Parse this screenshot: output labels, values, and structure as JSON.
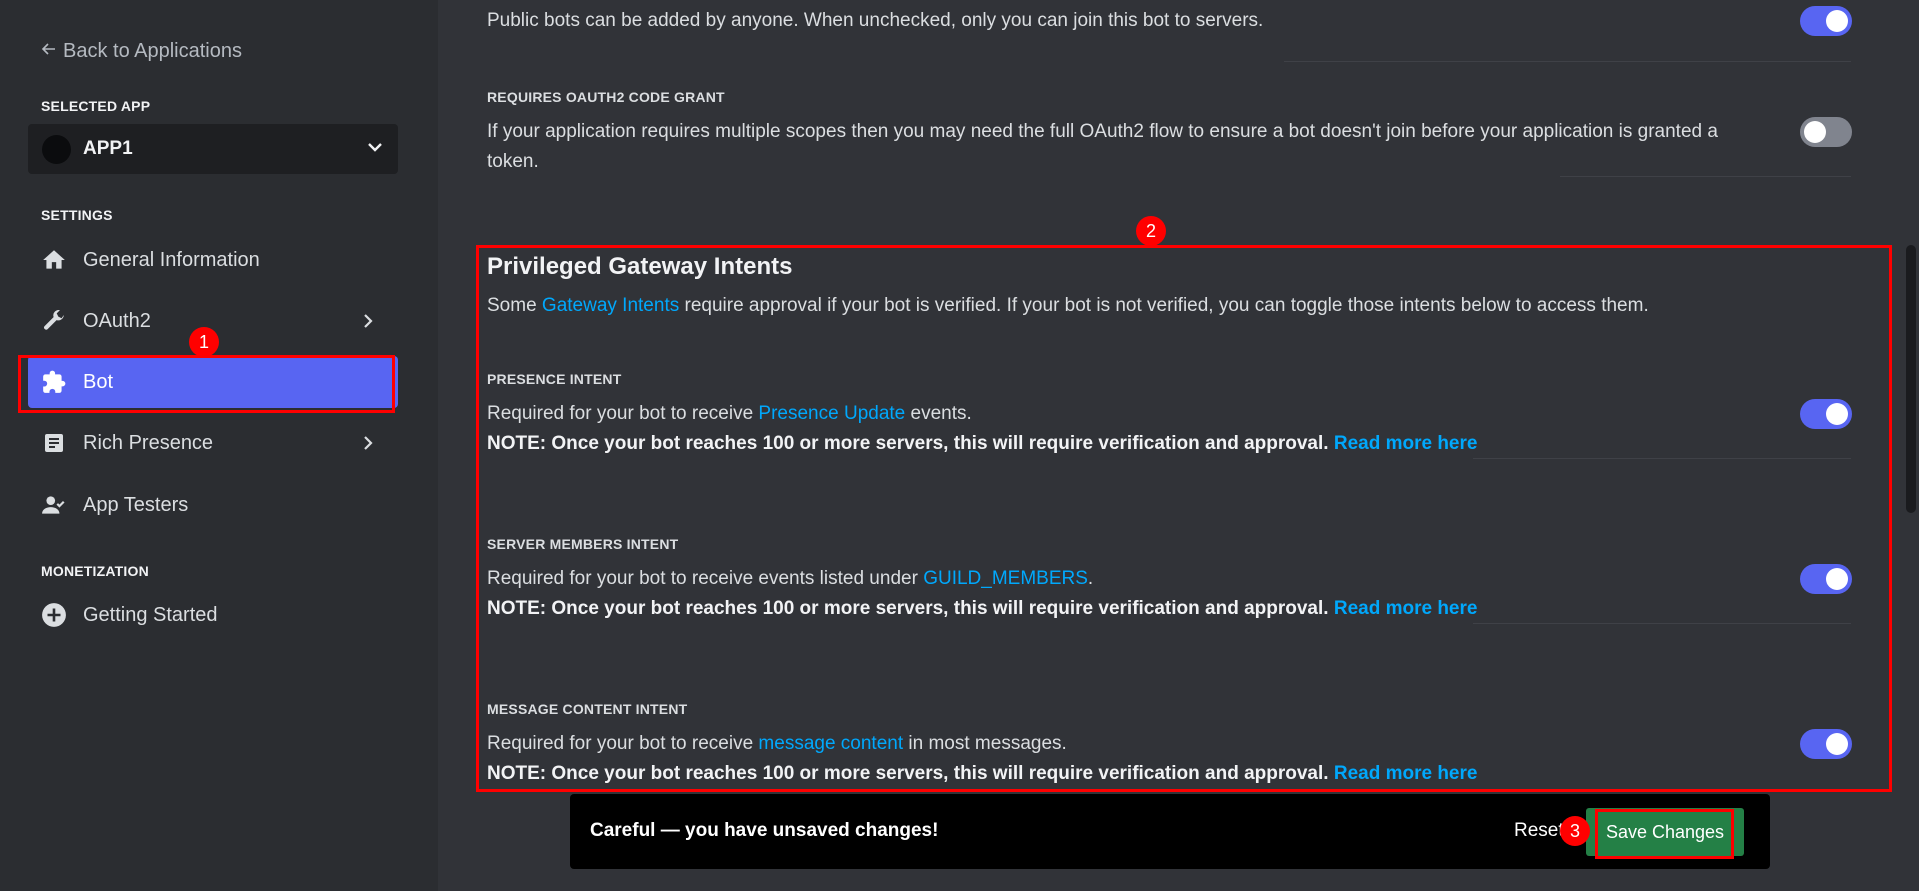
{
  "sidebar": {
    "back_label": "Back to Applications",
    "selected_app_label": "SELECTED APP",
    "app_name": "APP1",
    "settings_label": "SETTINGS",
    "items": [
      {
        "label": "General Information",
        "icon": "home-icon"
      },
      {
        "label": "OAuth2",
        "icon": "wrench-icon"
      },
      {
        "label": "Bot",
        "icon": "puzzle-icon"
      },
      {
        "label": "Rich Presence",
        "icon": "document-icon"
      },
      {
        "label": "App Testers",
        "icon": "person-icon"
      }
    ],
    "monetization_label": "MONETIZATION",
    "monetization_items": [
      {
        "label": "Getting Started",
        "icon": "plus-circle-icon"
      }
    ]
  },
  "public_bot": {
    "description": "Public bots can be added by anyone. When unchecked, only you can join this bot to servers.",
    "enabled": true
  },
  "oauth2_grant": {
    "title": "REQUIRES OAUTH2 CODE GRANT",
    "description_line1": "If your application requires multiple scopes then you may need the full OAuth2 flow to ensure a bot doesn't join before your application is granted a",
    "description_line2": "token.",
    "enabled": false
  },
  "intents": {
    "heading": "Privileged Gateway Intents",
    "intro_prefix": "Some ",
    "intro_link": "Gateway Intents",
    "intro_suffix": " require approval if your bot is verified. If your bot is not verified, you can toggle those intents below to access them.",
    "note_text": "NOTE: Once your bot reaches 100 or more servers, this will require verification and approval.",
    "read_more": "Read more here",
    "presence": {
      "title": "PRESENCE INTENT",
      "prefix": "Required for your bot to receive ",
      "link": "Presence Update",
      "suffix": " events.",
      "enabled": true
    },
    "members": {
      "title": "SERVER MEMBERS INTENT",
      "prefix": "Required for your bot to receive events listed under ",
      "link": "GUILD_MEMBERS",
      "suffix": ".",
      "enabled": true
    },
    "message_content": {
      "title": "MESSAGE CONTENT INTENT",
      "prefix": "Required for your bot to receive ",
      "link": "message content",
      "suffix": " in most messages.",
      "enabled": true
    }
  },
  "save_bar": {
    "message": "Careful — you have unsaved changes!",
    "reset_label": "Reset",
    "save_label": "Save Changes"
  },
  "annotations": [
    "1",
    "2",
    "3"
  ],
  "colors": {
    "accent": "#5865f2",
    "link": "#00a8fc",
    "save_green": "#248046",
    "annotation_red": "#ff0000"
  }
}
